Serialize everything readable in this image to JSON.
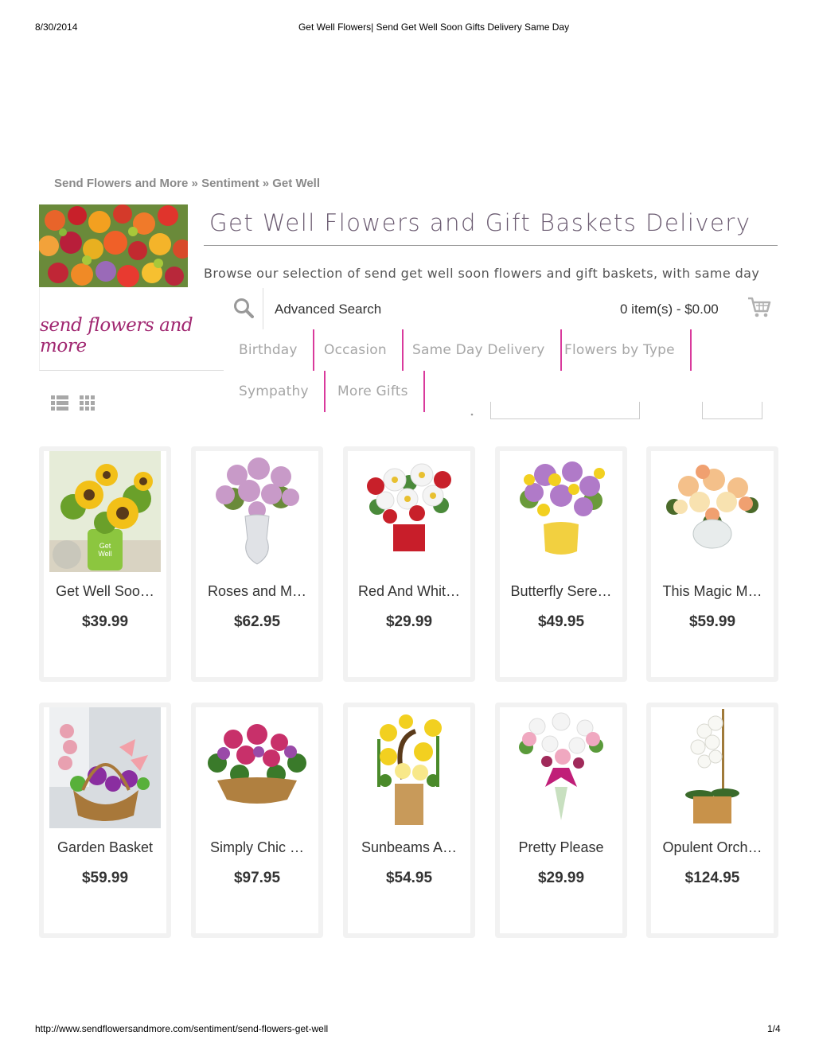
{
  "print": {
    "date": "8/30/2014",
    "title": "Get Well Flowers| Send Get Well Soon Gifts Delivery Same Day",
    "url": "http://www.sendflowersandmore.com/sentiment/send-flowers-get-well",
    "page": "1/4"
  },
  "breadcrumb": [
    "Send Flowers and More",
    "Sentiment",
    "Get Well"
  ],
  "breadcrumb_sep": " » ",
  "heading": "Get Well Flowers and Gift Baskets Delivery",
  "intro": "Browse our selection of send get well soon flowers and gift baskets, with same day",
  "logo": "send flowers and more",
  "header": {
    "search_icon": "search-icon",
    "advanced_search": "Advanced Search",
    "cart": "0 item(s) - $0.00",
    "cart_icon": "cart-icon"
  },
  "nav": [
    "Birthday",
    "Occasion",
    "Same Day Delivery",
    "Flowers by Type",
    "Sympathy",
    "More Gifts"
  ],
  "colors": {
    "accent": "#d93a9c",
    "logo": "#a02670",
    "heading": "#6a5a70"
  },
  "products": [
    {
      "name": "Get Well Soo…",
      "price": "$39.99"
    },
    {
      "name": "Roses and M…",
      "price": "$62.95"
    },
    {
      "name": "Red And Whit…",
      "price": "$29.99"
    },
    {
      "name": "Butterfly Sere…",
      "price": "$49.95"
    },
    {
      "name": "This Magic M…",
      "price": "$59.99"
    },
    {
      "name": "Garden Basket",
      "price": "$59.99"
    },
    {
      "name": "Simply Chic …",
      "price": "$97.95"
    },
    {
      "name": "Sunbeams A…",
      "price": "$54.95"
    },
    {
      "name": "Pretty Please",
      "price": "$29.99"
    },
    {
      "name": "Opulent Orch…",
      "price": "$124.95"
    }
  ]
}
